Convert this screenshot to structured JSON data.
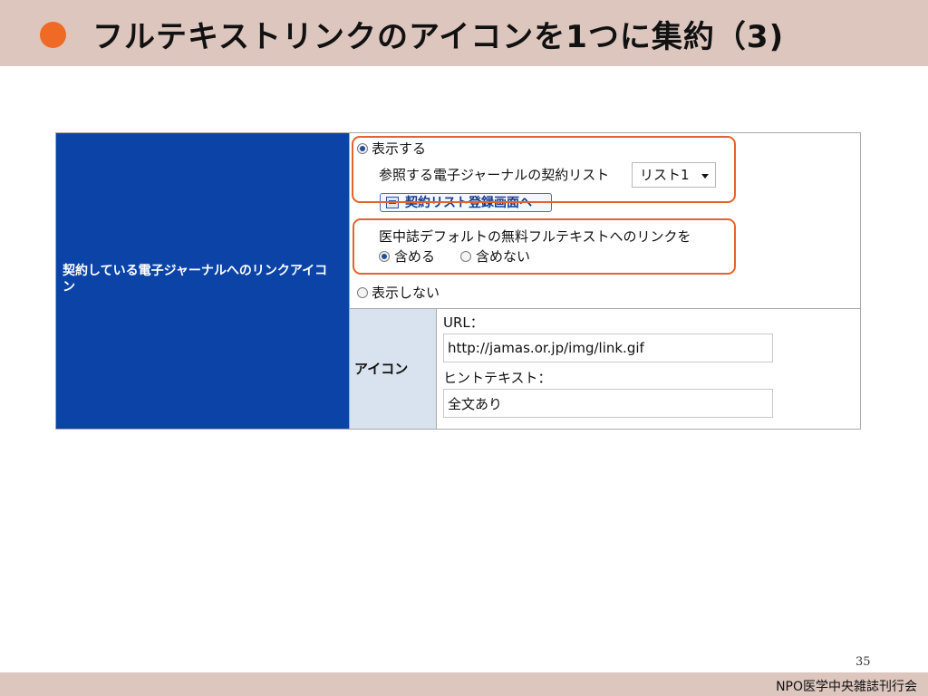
{
  "slide": {
    "title": "フルテキストリンクのアイコンを1つに集約（3)",
    "bullet_color": "#ef6a25",
    "page_number": "35",
    "footer": "NPO医学中央雑誌刊行会"
  },
  "settings": {
    "row_label": "契約している電子ジャーナルへのリンクアイコン",
    "show_option": "表示する",
    "contract_list_label": "参照する電子ジャーナルの契約リスト",
    "contract_list_value": "リスト1",
    "register_button": "契約リスト登録画面へ",
    "free_link_label": "医中誌デフォルトの無料フルテキストへのリンクを",
    "include_option": "含める",
    "exclude_option": "含めない",
    "hide_option": "表示しない",
    "icon_label": "アイコン",
    "url_label": "URL：",
    "url_value": "http://jamas.or.jp/img/link.gif",
    "hint_label": "ヒントテキスト：",
    "hint_value": "全文あり"
  }
}
